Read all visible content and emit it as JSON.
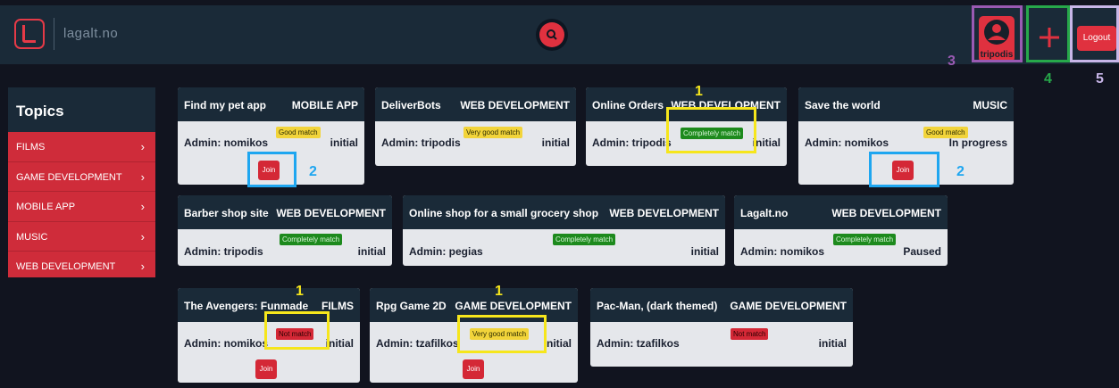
{
  "header": {
    "brand": "lagalt.no",
    "username": "tripodis",
    "logout_label": "Logout"
  },
  "icons": {
    "logo": "lagalt-logo-icon",
    "search": "search-icon",
    "profile": "user-icon",
    "add": "plus-icon"
  },
  "colors": {
    "accent_red": "#e0313f",
    "header_bg": "#1a2a38",
    "page_bg": "#11141f",
    "good_match": "#f2d43a",
    "completely_match": "#1d8a1d",
    "not_match": "#d42836",
    "annotation_yellow": "#f6e61c",
    "annotation_blue": "#1ea6f0",
    "annotation_purple": "#9a5ab3",
    "annotation_green": "#27a84a",
    "annotation_lilac": "#c8b6e8"
  },
  "sidebar": {
    "title": "Topics",
    "items": [
      {
        "label": "FILMS"
      },
      {
        "label": "GAME DEVELOPMENT"
      },
      {
        "label": "MOBILE APP"
      },
      {
        "label": "MUSIC"
      },
      {
        "label": "WEB DEVELOPMENT"
      }
    ]
  },
  "projects": [
    {
      "title": "Find my pet app",
      "category": "MOBILE APP",
      "admin": "Admin: nomikos",
      "match": "Good match",
      "status": "initial",
      "join": "Join"
    },
    {
      "title": "DeliverBots",
      "category": "WEB DEVELOPMENT",
      "admin": "Admin: tripodis",
      "match": "Very good match",
      "status": "initial"
    },
    {
      "title": "Online Orders",
      "category": "WEB DEVELOPMENT",
      "admin": "Admin: tripodis",
      "match": "Completely match",
      "status": "initial"
    },
    {
      "title": "Save the world",
      "category": "MUSIC",
      "admin": "Admin: nomikos",
      "match": "Good match",
      "status": "In progress",
      "join": "Join"
    },
    {
      "title": "Barber shop site",
      "category": "WEB DEVELOPMENT",
      "admin": "Admin: tripodis",
      "match": "Completely match",
      "status": "initial"
    },
    {
      "title": "Online shop for a small grocery shop",
      "category": "WEB DEVELOPMENT",
      "admin": "Admin: pegias",
      "match": "Completely match",
      "status": "initial"
    },
    {
      "title": "Lagalt.no",
      "category": "WEB DEVELOPMENT",
      "admin": "Admin: nomikos",
      "match": "Completely match",
      "status": "Paused"
    },
    {
      "title": "The Avengers: Funmade",
      "category": "FILMS",
      "admin": "Admin: nomikos",
      "match": "Not match",
      "status": "initial",
      "join": "Join"
    },
    {
      "title": "Rpg Game 2D",
      "category": "GAME DEVELOPMENT",
      "admin": "Admin: tzafilkos",
      "match": "Very good match",
      "status": "initial",
      "join": "Join"
    },
    {
      "title": "Pac-Man, (dark themed)",
      "category": "GAME DEVELOPMENT",
      "admin": "Admin: tzafilkos",
      "match": "Not match",
      "status": "initial"
    }
  ],
  "annotations": {
    "n1": "1",
    "n2": "2",
    "n3": "3",
    "n4": "4",
    "n5": "5"
  }
}
